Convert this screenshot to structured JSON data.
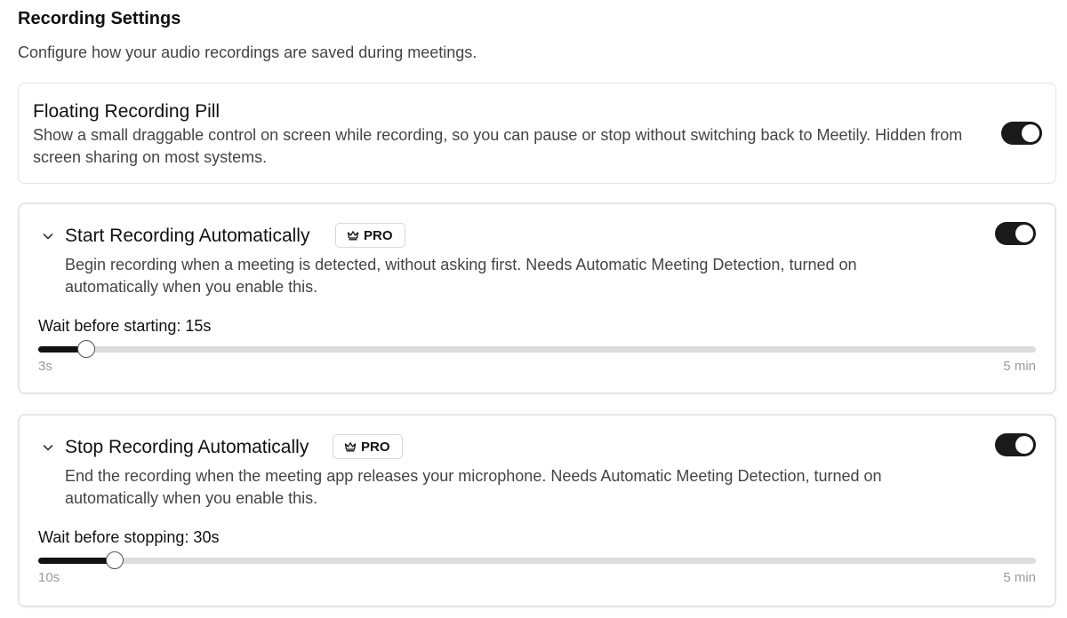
{
  "header": {
    "title": "Recording Settings",
    "subtitle": "Configure how your audio recordings are saved during meetings."
  },
  "floating_pill": {
    "title": "Floating Recording Pill",
    "description": "Show a small draggable control on screen while recording, so you can pause or stop without switching back to Meetily. Hidden from screen sharing on most systems.",
    "enabled": true
  },
  "start_recording": {
    "title": "Start Recording Automatically",
    "badge": "PRO",
    "description": "Begin recording when a meeting is detected, without asking first. Needs Automatic Meeting Detection, turned on automatically when you enable this.",
    "enabled": true,
    "slider": {
      "label": "Wait before starting: 15s",
      "min_label": "3s",
      "max_label": "5 min",
      "fraction": 0.048
    }
  },
  "stop_recording": {
    "title": "Stop Recording Automatically",
    "badge": "PRO",
    "description": "End the recording when the meeting app releases your microphone. Needs Automatic Meeting Detection, turned on automatically when you enable this.",
    "enabled": true,
    "slider": {
      "label": "Wait before stopping: 30s",
      "min_label": "10s",
      "max_label": "5 min",
      "fraction": 0.077
    }
  },
  "colors": {
    "toggle_on": "#1a1a1a",
    "track": "#dcdcdc",
    "fill": "#111111",
    "muted_text": "#9a9a9a"
  }
}
